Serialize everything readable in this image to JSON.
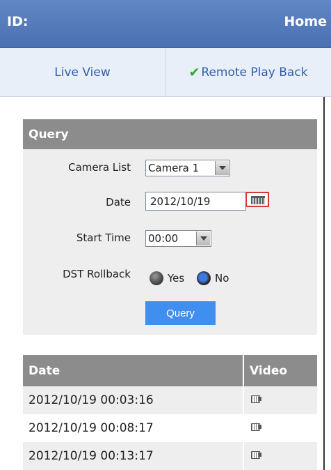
{
  "header": {
    "id_label": "ID:",
    "home_label": "Home"
  },
  "tabs": {
    "live_view": "Live View",
    "remote_play_back": "Remote Play Back",
    "active": "remote_play_back"
  },
  "query": {
    "title": "Query",
    "camera_list_label": "Camera List",
    "camera_selected": "Camera 1",
    "date_label": "Date",
    "date_value": "2012/10/19",
    "start_time_label": "Start Time",
    "start_time_selected": "00:00",
    "dst_rollback_label": "DST Rollback",
    "dst_options": [
      {
        "label": "Yes",
        "selected": false
      },
      {
        "label": "No",
        "selected": true
      }
    ],
    "button_label": "Query"
  },
  "results": {
    "headers": [
      "Date",
      "Video"
    ],
    "rows": [
      {
        "date": "2012/10/19 00:03:16",
        "icon": "video-file-icon"
      },
      {
        "date": "2012/10/19 00:08:17",
        "icon": "video-file-icon"
      },
      {
        "date": "2012/10/19 00:13:17",
        "icon": "video-file-icon"
      }
    ]
  },
  "colors": {
    "header_blue": "#5a7fbe",
    "tab_link": "#2e5fa8",
    "check_green": "#2eaa2e",
    "panel_head_gray": "#8c8c8c",
    "button_blue": "#3f8ef0",
    "calendar_outline_red": "#d23a3a"
  }
}
